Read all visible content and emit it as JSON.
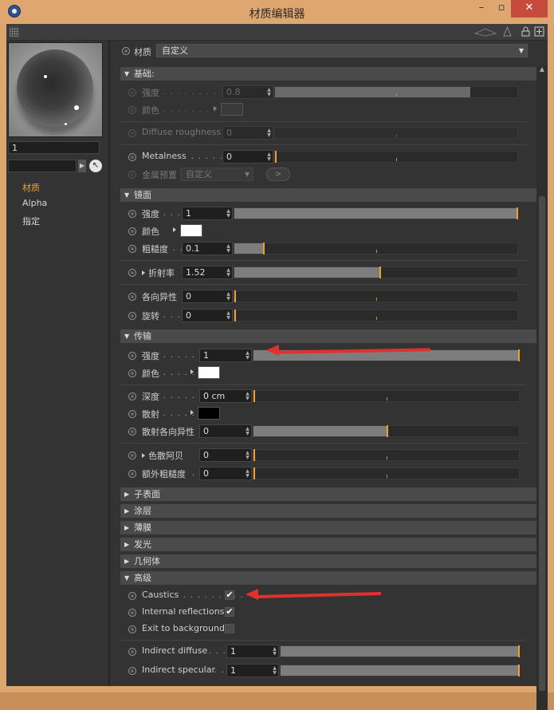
{
  "window": {
    "title": "材质编辑器",
    "minimize": "–",
    "maximize": "▫",
    "close": "✕"
  },
  "toolbar": {
    "icons": [
      "grip-icon",
      "stack-icon",
      "person-icon",
      "lock-icon",
      "new-window-icon"
    ]
  },
  "left_panel": {
    "material_name": "1",
    "channels": [
      {
        "label": "材质",
        "active": true
      },
      {
        "label": "Alpha",
        "active": false
      },
      {
        "label": "指定",
        "active": false
      }
    ]
  },
  "material_row": {
    "label": "材质",
    "dropdown": "自定义"
  },
  "sections": {
    "basic": {
      "title": "基础:"
    },
    "mirror": {
      "title": "镜面"
    },
    "transmission": {
      "title": "传输"
    },
    "subsurface": {
      "title": "子表面"
    },
    "coating": {
      "title": "涂层"
    },
    "film": {
      "title": "薄膜"
    },
    "emission": {
      "title": "发光"
    },
    "geometry": {
      "title": "几何体"
    },
    "advanced": {
      "title": "高级"
    }
  },
  "basic": {
    "strength": {
      "label": "强度",
      "dots": " . . . . . . . . . . . .",
      "value": "0.8",
      "level": 0.8
    },
    "color": {
      "label": "颜色",
      "dots": " . . . . . . . . ."
    },
    "diffuse_roughness": {
      "label": "Diffuse roughness",
      "value": "0",
      "level": 0
    },
    "metalness": {
      "label": "Metalness",
      "dots": " . . . . . . .",
      "value": "0",
      "level": 0
    },
    "metal_preset": {
      "label": "金属预置",
      "dropdown": "自定义",
      "button": ">"
    }
  },
  "mirror": {
    "strength": {
      "label": "强度",
      "dots": " . . .",
      "value": "1",
      "level": 1
    },
    "color": {
      "label": "颜色"
    },
    "roughness": {
      "label": "粗糙度",
      "dots": " . .",
      "value": "0.1",
      "level": 0.1
    },
    "ior": {
      "label": "折射率",
      "value": "1.52",
      "level": 0.5
    },
    "anisotropy": {
      "label": "各向异性",
      "value": "0",
      "level": 0
    },
    "rotation": {
      "label": "旋转",
      "dots": " . . .",
      "value": "0",
      "level": 0
    }
  },
  "transmission": {
    "strength": {
      "label": "强度",
      "dots": " . . . . . . .",
      "value": "1",
      "level": 1
    },
    "color": {
      "label": "颜色",
      "dots": " . . . . ."
    },
    "depth": {
      "label": "深度",
      "dots": " . . . . . . .",
      "value": "0 cm",
      "level": 0
    },
    "scatter": {
      "label": "散射",
      "dots": " . . . . ."
    },
    "scatter_anisotropy": {
      "label": "散射各向异性",
      "value": "0",
      "level": 0.5
    },
    "dispersion_abbe": {
      "label": "色散阿贝",
      "value": "0",
      "level": 0
    },
    "extra_roughness": {
      "label": "额外粗糙度",
      "dots": " .",
      "value": "0",
      "level": 0
    }
  },
  "advanced": {
    "caustics": {
      "label": "Caustics",
      "dots": " . . . . . . . . .",
      "checked": true,
      "check": "✔"
    },
    "internal_reflections": {
      "label": "Internal reflections",
      "checked": true,
      "check": "✔"
    },
    "exit_to_background": {
      "label": "Exit to background",
      "checked": false,
      "check": ""
    },
    "indirect_diffuse": {
      "label": "Indirect diffuse",
      "dots": " . . .",
      "value": "1",
      "level": 1
    },
    "indirect_specular": {
      "label": "Indirect specular",
      "dots": " . .",
      "value": "1",
      "level": 1
    }
  },
  "colors": {
    "accent": "#f0a030",
    "annotation_arrow": "#e0312f",
    "white_swatch": "#ffffff",
    "black_swatch": "#000000"
  }
}
